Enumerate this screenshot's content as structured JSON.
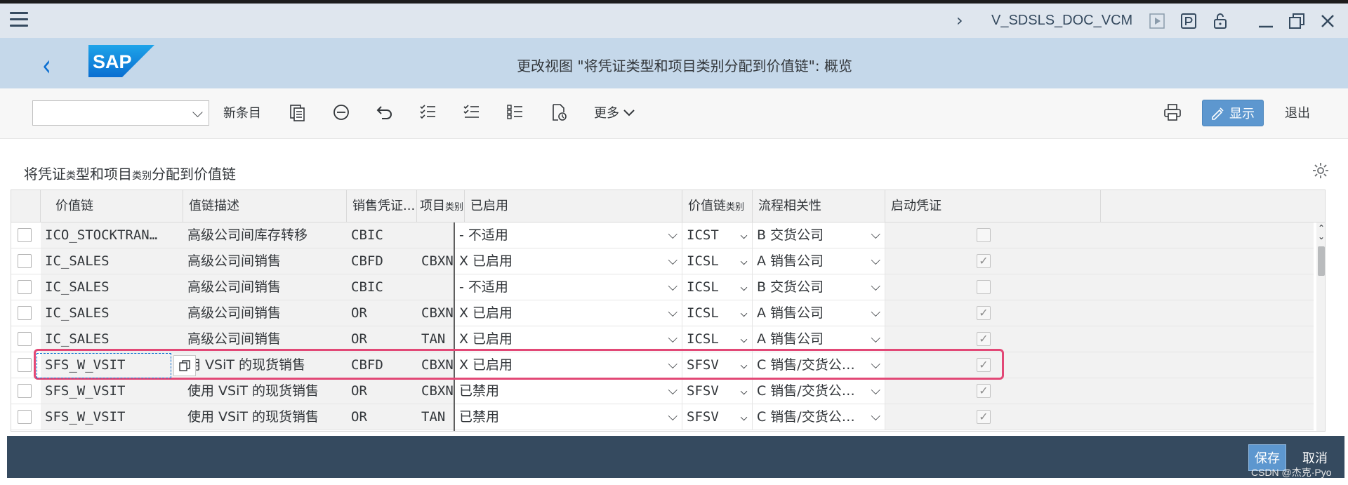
{
  "window": {
    "tcode": "V_SDSLS_DOC_VCM",
    "icons": [
      "menu-icon",
      "expand-arrow-icon",
      "play-icon",
      "parking-icon",
      "unlock-icon",
      "minimize-icon",
      "restore-icon",
      "close-icon"
    ]
  },
  "header": {
    "title": "更改视图 \"将凭证类型和项目类别分配到价值链\": 概览",
    "logo_text": "SAP"
  },
  "toolbar": {
    "combo_value": "",
    "new_entry": "新条目",
    "more": "更多",
    "display": "显示",
    "exit": "退出"
  },
  "section": {
    "title_main": "将凭证",
    "title_small": "类",
    "title_rest": "型和项目",
    "title_small2": "类别",
    "title_end": "分配到价值链"
  },
  "table": {
    "columns": [
      {
        "label": "价值链"
      },
      {
        "label": "值链描述"
      },
      {
        "label": "销售凭证..."
      },
      {
        "label": "项目",
        "small": "类别"
      },
      {
        "label": "已启用"
      },
      {
        "label": "价值链",
        "small": "类别"
      },
      {
        "label": "流程相关性"
      },
      {
        "label": "启动凭证"
      }
    ],
    "rows": [
      {
        "chain": "ICO_STOCKTRAN…",
        "desc": "高级公司间库存转移",
        "doc": "CBIC",
        "item": "",
        "enabled": "- 不适用",
        "cat": "ICST",
        "proc": "B 交货公司",
        "start": false
      },
      {
        "chain": "IC_SALES",
        "desc": "高级公司间销售",
        "doc": "CBFD",
        "item": "CBXN",
        "enabled": "X 已启用",
        "cat": "ICSL",
        "proc": "A 销售公司",
        "start": true
      },
      {
        "chain": "IC_SALES",
        "desc": "高级公司间销售",
        "doc": "CBIC",
        "item": "",
        "enabled": "- 不适用",
        "cat": "ICSL",
        "proc": "B 交货公司",
        "start": false
      },
      {
        "chain": "IC_SALES",
        "desc": "高级公司间销售",
        "doc": "OR",
        "item": "CBXN",
        "enabled": "X 已启用",
        "cat": "ICSL",
        "proc": "A 销售公司",
        "start": true
      },
      {
        "chain": "IC_SALES",
        "desc": "高级公司间销售",
        "doc": "OR",
        "item": "TAN",
        "enabled": "X 已启用",
        "cat": "ICSL",
        "proc": "A 销售公司",
        "start": true
      },
      {
        "chain": "SFS_W_VSIT",
        "desc": "用 VSiT 的现货销售",
        "doc": "CBFD",
        "item": "CBXN",
        "enabled": "X 已启用",
        "cat": "SFSV",
        "proc": "C 销售/交货公…",
        "start": true
      },
      {
        "chain": "SFS_W_VSIT",
        "desc": "使用 VSiT 的现货销售",
        "doc": "OR",
        "item": "CBXN",
        "enabled": "  已禁用",
        "cat": "SFSV",
        "proc": "C 销售/交货公…",
        "start": true
      },
      {
        "chain": "SFS_W_VSIT",
        "desc": "使用 VSiT 的现货销售",
        "doc": "OR",
        "item": "TAN",
        "enabled": "  已禁用",
        "cat": "SFSV",
        "proc": "C 销售/交货公…",
        "start": true
      }
    ]
  },
  "footer": {
    "save": "保存",
    "cancel": "取消"
  },
  "watermark": "CSDN @杰克·Pyo"
}
